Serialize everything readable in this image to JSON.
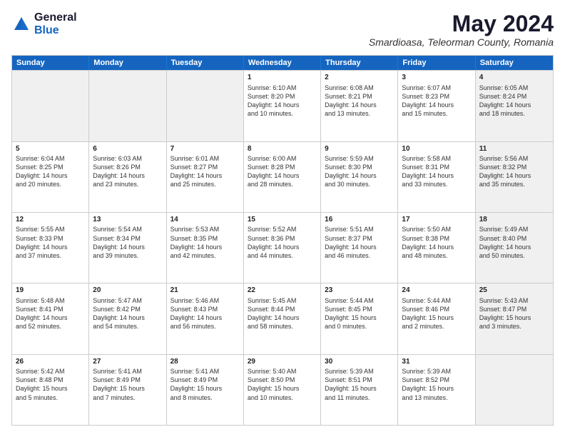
{
  "header": {
    "logo_general": "General",
    "logo_blue": "Blue",
    "month_year": "May 2024",
    "location": "Smardioasa, Teleorman County, Romania"
  },
  "days_of_week": [
    "Sunday",
    "Monday",
    "Tuesday",
    "Wednesday",
    "Thursday",
    "Friday",
    "Saturday"
  ],
  "weeks": [
    [
      {
        "day": "",
        "info": "",
        "shaded": true
      },
      {
        "day": "",
        "info": "",
        "shaded": true
      },
      {
        "day": "",
        "info": "",
        "shaded": true
      },
      {
        "day": "1",
        "info": "Sunrise: 6:10 AM\nSunset: 8:20 PM\nDaylight: 14 hours\nand 10 minutes.",
        "shaded": false
      },
      {
        "day": "2",
        "info": "Sunrise: 6:08 AM\nSunset: 8:21 PM\nDaylight: 14 hours\nand 13 minutes.",
        "shaded": false
      },
      {
        "day": "3",
        "info": "Sunrise: 6:07 AM\nSunset: 8:23 PM\nDaylight: 14 hours\nand 15 minutes.",
        "shaded": false
      },
      {
        "day": "4",
        "info": "Sunrise: 6:05 AM\nSunset: 8:24 PM\nDaylight: 14 hours\nand 18 minutes.",
        "shaded": true
      }
    ],
    [
      {
        "day": "5",
        "info": "Sunrise: 6:04 AM\nSunset: 8:25 PM\nDaylight: 14 hours\nand 20 minutes.",
        "shaded": false
      },
      {
        "day": "6",
        "info": "Sunrise: 6:03 AM\nSunset: 8:26 PM\nDaylight: 14 hours\nand 23 minutes.",
        "shaded": false
      },
      {
        "day": "7",
        "info": "Sunrise: 6:01 AM\nSunset: 8:27 PM\nDaylight: 14 hours\nand 25 minutes.",
        "shaded": false
      },
      {
        "day": "8",
        "info": "Sunrise: 6:00 AM\nSunset: 8:28 PM\nDaylight: 14 hours\nand 28 minutes.",
        "shaded": false
      },
      {
        "day": "9",
        "info": "Sunrise: 5:59 AM\nSunset: 8:30 PM\nDaylight: 14 hours\nand 30 minutes.",
        "shaded": false
      },
      {
        "day": "10",
        "info": "Sunrise: 5:58 AM\nSunset: 8:31 PM\nDaylight: 14 hours\nand 33 minutes.",
        "shaded": false
      },
      {
        "day": "11",
        "info": "Sunrise: 5:56 AM\nSunset: 8:32 PM\nDaylight: 14 hours\nand 35 minutes.",
        "shaded": true
      }
    ],
    [
      {
        "day": "12",
        "info": "Sunrise: 5:55 AM\nSunset: 8:33 PM\nDaylight: 14 hours\nand 37 minutes.",
        "shaded": false
      },
      {
        "day": "13",
        "info": "Sunrise: 5:54 AM\nSunset: 8:34 PM\nDaylight: 14 hours\nand 39 minutes.",
        "shaded": false
      },
      {
        "day": "14",
        "info": "Sunrise: 5:53 AM\nSunset: 8:35 PM\nDaylight: 14 hours\nand 42 minutes.",
        "shaded": false
      },
      {
        "day": "15",
        "info": "Sunrise: 5:52 AM\nSunset: 8:36 PM\nDaylight: 14 hours\nand 44 minutes.",
        "shaded": false
      },
      {
        "day": "16",
        "info": "Sunrise: 5:51 AM\nSunset: 8:37 PM\nDaylight: 14 hours\nand 46 minutes.",
        "shaded": false
      },
      {
        "day": "17",
        "info": "Sunrise: 5:50 AM\nSunset: 8:38 PM\nDaylight: 14 hours\nand 48 minutes.",
        "shaded": false
      },
      {
        "day": "18",
        "info": "Sunrise: 5:49 AM\nSunset: 8:40 PM\nDaylight: 14 hours\nand 50 minutes.",
        "shaded": true
      }
    ],
    [
      {
        "day": "19",
        "info": "Sunrise: 5:48 AM\nSunset: 8:41 PM\nDaylight: 14 hours\nand 52 minutes.",
        "shaded": false
      },
      {
        "day": "20",
        "info": "Sunrise: 5:47 AM\nSunset: 8:42 PM\nDaylight: 14 hours\nand 54 minutes.",
        "shaded": false
      },
      {
        "day": "21",
        "info": "Sunrise: 5:46 AM\nSunset: 8:43 PM\nDaylight: 14 hours\nand 56 minutes.",
        "shaded": false
      },
      {
        "day": "22",
        "info": "Sunrise: 5:45 AM\nSunset: 8:44 PM\nDaylight: 14 hours\nand 58 minutes.",
        "shaded": false
      },
      {
        "day": "23",
        "info": "Sunrise: 5:44 AM\nSunset: 8:45 PM\nDaylight: 15 hours\nand 0 minutes.",
        "shaded": false
      },
      {
        "day": "24",
        "info": "Sunrise: 5:44 AM\nSunset: 8:46 PM\nDaylight: 15 hours\nand 2 minutes.",
        "shaded": false
      },
      {
        "day": "25",
        "info": "Sunrise: 5:43 AM\nSunset: 8:47 PM\nDaylight: 15 hours\nand 3 minutes.",
        "shaded": true
      }
    ],
    [
      {
        "day": "26",
        "info": "Sunrise: 5:42 AM\nSunset: 8:48 PM\nDaylight: 15 hours\nand 5 minutes.",
        "shaded": false
      },
      {
        "day": "27",
        "info": "Sunrise: 5:41 AM\nSunset: 8:49 PM\nDaylight: 15 hours\nand 7 minutes.",
        "shaded": false
      },
      {
        "day": "28",
        "info": "Sunrise: 5:41 AM\nSunset: 8:49 PM\nDaylight: 15 hours\nand 8 minutes.",
        "shaded": false
      },
      {
        "day": "29",
        "info": "Sunrise: 5:40 AM\nSunset: 8:50 PM\nDaylight: 15 hours\nand 10 minutes.",
        "shaded": false
      },
      {
        "day": "30",
        "info": "Sunrise: 5:39 AM\nSunset: 8:51 PM\nDaylight: 15 hours\nand 11 minutes.",
        "shaded": false
      },
      {
        "day": "31",
        "info": "Sunrise: 5:39 AM\nSunset: 8:52 PM\nDaylight: 15 hours\nand 13 minutes.",
        "shaded": false
      },
      {
        "day": "",
        "info": "",
        "shaded": true
      }
    ]
  ]
}
